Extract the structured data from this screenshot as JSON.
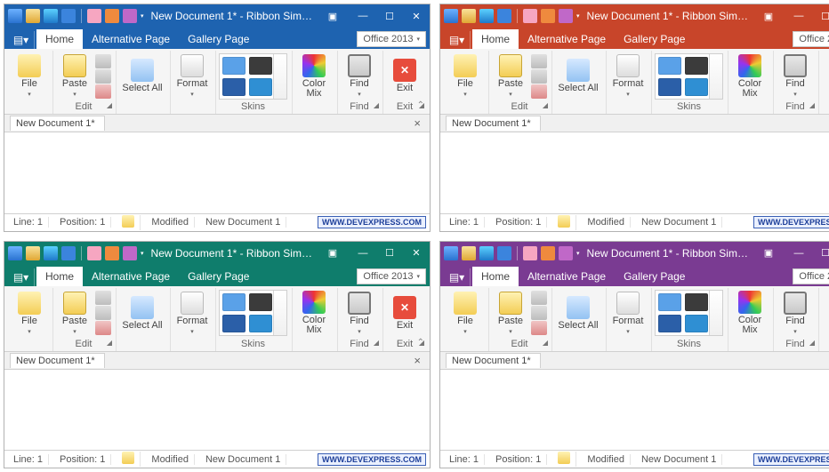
{
  "window": {
    "title": "New Document 1* - Ribbon Sim…",
    "qat_dropdown_glyph": "▾"
  },
  "tabs": {
    "home": "Home",
    "alt": "Alternative Page",
    "gallery": "Gallery Page",
    "office_style": "Office 2013"
  },
  "ribbon": {
    "file": "File",
    "paste": "Paste",
    "edit_group": "Edit",
    "select_all": "Select All",
    "format": "Format",
    "skins_group": "Skins",
    "colormix": "Color Mix",
    "find": "Find",
    "find_group": "Find",
    "exit": "Exit",
    "exit_group": "Exit"
  },
  "doc_tab": "New Document 1*",
  "status": {
    "line": "Line: 1",
    "pos": "Position: 1",
    "modified": "Modified",
    "docname": "New Document 1",
    "brand": "WWW.DEVEXPRESS.COM"
  },
  "themes": [
    "th-blue",
    "th-red",
    "th-green",
    "th-purple"
  ]
}
